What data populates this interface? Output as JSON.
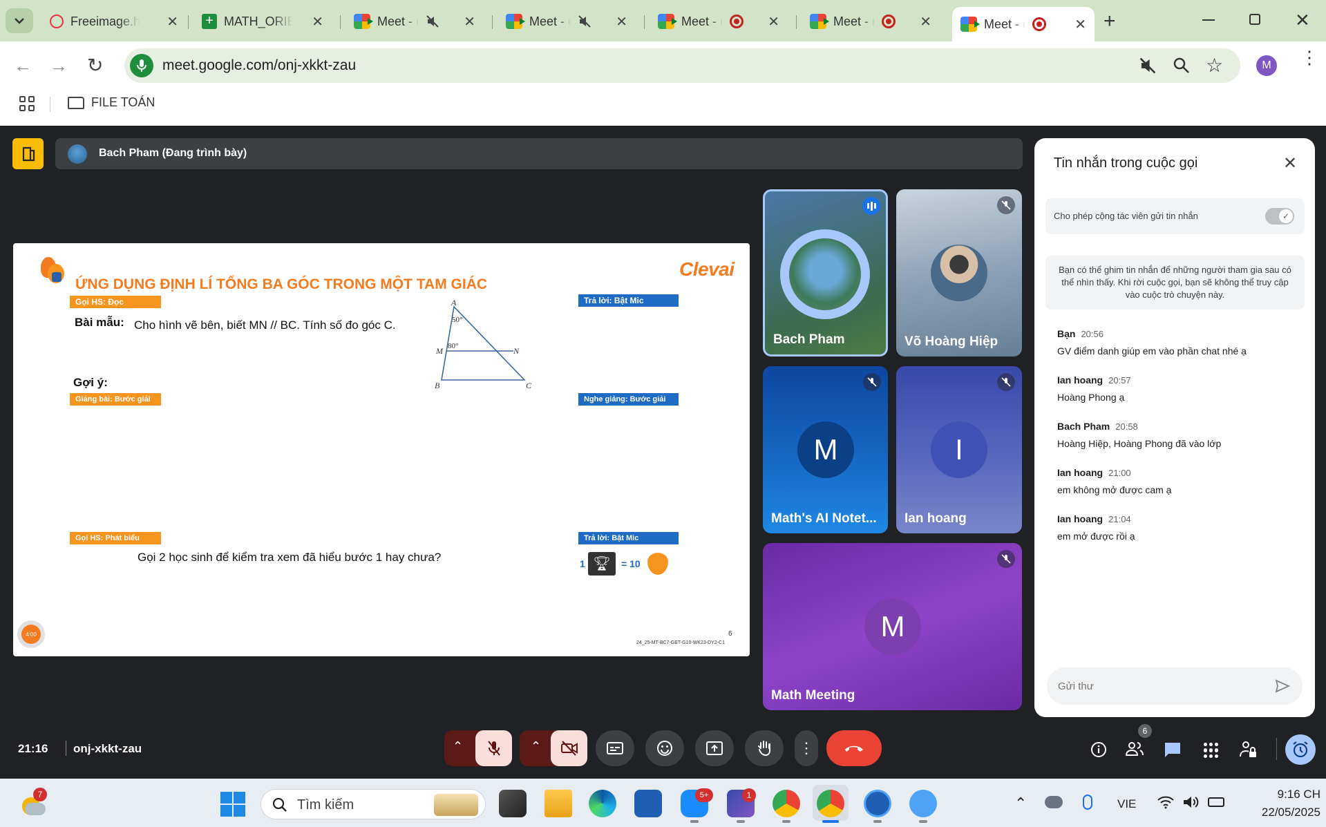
{
  "browser": {
    "tabs": [
      {
        "title": "Freeimage.host",
        "icon": "freeimage-icon"
      },
      {
        "title": "MATH_ORIENT",
        "icon": "sheets-icon"
      },
      {
        "title": "Meet - cpr",
        "icon": "meet-icon"
      },
      {
        "title": "Meet - cip",
        "icon": "meet-icon"
      },
      {
        "title": "Meet - dg",
        "icon": "meet-icon"
      },
      {
        "title": "Meet - mf",
        "icon": "meet-icon"
      },
      {
        "title": "Meet - onj",
        "icon": "meet-icon"
      }
    ],
    "url": "meet.google.com/onj-xkkt-zau",
    "profile_initial": "M",
    "bookmark_folder": "FILE TOÁN"
  },
  "meet": {
    "presenter_label": "Bach Pham (Đang trình bày)",
    "time": "21:16",
    "code": "onj-xkkt-zau",
    "participant_count": "6"
  },
  "slide": {
    "title": "ỨNG DỤNG ĐỊNH LÍ TỔNG BA GÓC TRONG MỘT TAM GIÁC",
    "brand": "Clevai",
    "tag_read": "Gọi HS: Đọc",
    "tag_answer1": "Trả lời: Bật Mic",
    "example_label": "Bài mẫu:",
    "example_text": "Cho hình vẽ bên, biết MN // BC. Tính số đo góc C.",
    "hint_label": "Gợi ý:",
    "tag_teach": "Giảng bài: Bước giải",
    "tag_listen": "Nghe giảng: Bước giải",
    "tag_speak": "Gọi HS: Phát biểu",
    "tag_answer2": "Trả lời: Bật Mic",
    "question": "Gọi 2 học sinh để kiểm tra xem đã hiểu bước 1 hay chưa?",
    "reward_count": "1",
    "reward_value": "= 10",
    "page_number": "6",
    "slide_code": "24_25-MT-BC7-GET-G10-WK23-DY2-C1",
    "timer": "4:00",
    "figure": {
      "A": "A",
      "B": "B",
      "C": "C",
      "M": "M",
      "N": "N",
      "angle_a": "50°",
      "angle_m": "80°"
    }
  },
  "participants": [
    {
      "name": "Bach Pham",
      "initial": "",
      "color": "#5aa0d8"
    },
    {
      "name": "Võ Hoàng Hiệp",
      "initial": "",
      "color": "#a3b7c9"
    },
    {
      "name": "Math's AI Notet...",
      "initial": "M",
      "color": "#1565c0"
    },
    {
      "name": "Ian hoang",
      "initial": "I",
      "color": "#3f51b5"
    },
    {
      "name": "Math Meeting",
      "initial": "M",
      "color": "#7b3fb0"
    }
  ],
  "chat": {
    "title": "Tin nhắn trong cuộc gọi",
    "toggle_label": "Cho phép cộng tác viên gửi tin nhắn",
    "notice": "Bạn có thể ghim tin nhắn để những người tham gia sau có thể nhìn thấy. Khi rời cuộc gọi, bạn sẽ không thể truy cập vào cuộc trò chuyện này.",
    "messages": [
      {
        "sender": "Bạn",
        "time": "20:56",
        "text": "GV điểm danh giúp em vào phần chat nhé ạ"
      },
      {
        "sender": "Ian hoang",
        "time": "20:57",
        "text": "Hoàng Phong ạ"
      },
      {
        "sender": "Bach Pham",
        "time": "20:58",
        "text": "Hoàng Hiệp, Hoàng Phong đã vào lớp"
      },
      {
        "sender": "Ian hoang",
        "time": "21:00",
        "text": "em không mở được cam ạ"
      },
      {
        "sender": "Ian hoang",
        "time": "21:04",
        "text": "em mở được rồi ạ"
      }
    ],
    "input_placeholder": "Gửi thư"
  },
  "taskbar": {
    "weather_badge": "7",
    "search_placeholder": "Tìm kiếm",
    "zalo_badge": "5+",
    "app_badge": "1",
    "language": "VIE",
    "clock_time": "9:16 CH",
    "clock_date": "22/05/2025"
  },
  "colors": {
    "tabstrip": "#d3e3c8",
    "meet_bg": "#202124",
    "end_call": "#ea4335",
    "muted_control": "#f9dedc",
    "slide_orange": "#f47b20",
    "slide_blue": "#1e6bc6"
  }
}
